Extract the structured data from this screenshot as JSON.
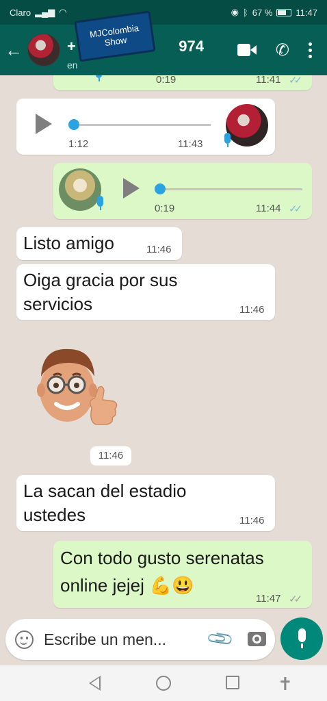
{
  "status_bar": {
    "carrier": "Claro",
    "battery": "67 %",
    "time": "11:47"
  },
  "header": {
    "title_prefix": "+",
    "title_suffix": "974",
    "subtitle": "en",
    "watermark_line1": "MJColombia",
    "watermark_line2": "Show"
  },
  "messages": [
    {
      "type": "voice",
      "direction": "out",
      "duration": "0:19",
      "time": "11:41"
    },
    {
      "type": "voice",
      "direction": "in",
      "duration": "1:12",
      "time": "11:43"
    },
    {
      "type": "voice",
      "direction": "out",
      "duration": "0:19",
      "time": "11:44"
    },
    {
      "type": "text",
      "direction": "in",
      "text": "Listo amigo",
      "time": "11:46"
    },
    {
      "type": "text",
      "direction": "in",
      "line1": "Oiga gracia por sus",
      "line2": "servicios",
      "time": "11:46"
    },
    {
      "type": "sticker",
      "direction": "in",
      "time": "11:46"
    },
    {
      "type": "text",
      "direction": "in",
      "line1": "La sacan del estadio",
      "line2": "ustedes",
      "time": "11:46"
    },
    {
      "type": "text",
      "direction": "out",
      "line1": "Con todo gusto serenatas",
      "line2": "online jejej",
      "emojis": "💪😃",
      "time": "11:47"
    }
  ],
  "composer": {
    "placeholder": "Escribe un men..."
  },
  "colors": {
    "header": "#075e54",
    "status": "#054d44",
    "incoming": "#ffffff",
    "outgoing": "#dcf8c6",
    "accent": "#00897b",
    "read_ticks": "#7db7d8"
  }
}
